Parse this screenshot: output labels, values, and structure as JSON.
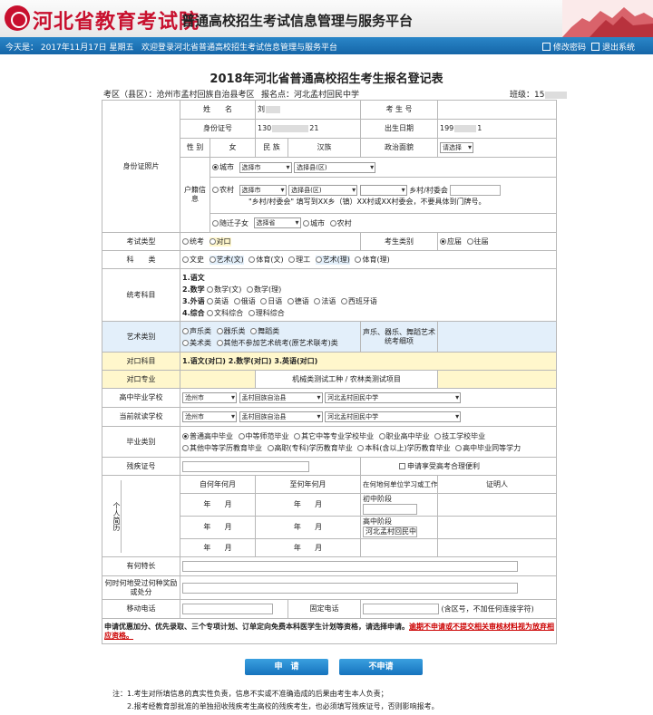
{
  "header": {
    "logo_text": "河北省教育考试院",
    "platform_title": "普通高校招生考试信息管理与服务平台"
  },
  "navbar": {
    "date_text": "今天是： 2017年11月17日 星期五",
    "welcome_text": "欢迎登录河北省普通高校招生考试信息管理与服务平台",
    "change_password": "修改密码",
    "logout": "退出系统"
  },
  "form": {
    "title": "2018年河北省普通高校招生考生报名登记表",
    "district_label": "考区（县区）：",
    "district_value": "沧州市孟村回族自治县考区",
    "school_label": "报名点：",
    "school_value": "河北孟村回民中学",
    "class_label": "班级：",
    "class_value": "15",
    "photo_label": "身份证照片",
    "name_label": "姓　　名",
    "name_value": "刘",
    "exam_no_label": "考 生 号",
    "exam_no_value": "",
    "id_label": "身份证号",
    "id_value_prefix": "130",
    "id_value_suffix": "21",
    "birth_label": "出生日期",
    "birth_value_prefix": "199",
    "birth_value_suffix": "1",
    "gender_label": "性 别",
    "gender_value": "女",
    "ethnic_label": "民 族",
    "ethnic_value": "汉族",
    "political_label": "政治面貌",
    "political_value": "请选择",
    "hukou_label": "户籍信息",
    "city_option": "城市",
    "city_select": "选择市",
    "county_select": "选择县(区)",
    "rural_option": "农村",
    "rural_city_select": "选择市",
    "rural_county_select": "选择县(区)",
    "village_label": "乡村/村委会",
    "village_note": "\"乡村/村委会\" 填写到XX乡（镇）XX村或XX村委会，不要具体到门牌号。",
    "migrant_option": "随迁子女",
    "migrant_select": "选择省",
    "migrant_city": "城市",
    "migrant_rural": "农村",
    "exam_type_label": "考试类型",
    "exam_type_options": [
      "统考",
      "对口"
    ],
    "student_cat_label": "考生类别",
    "student_cat_options": [
      "应届",
      "往届"
    ],
    "subject_label": "科　　类",
    "subject_options": [
      "文史",
      "艺术(文)",
      "体育(文)",
      "理工",
      "艺术(理)",
      "体育(理)"
    ],
    "unified_label": "统考科目",
    "unified_1": "1.语文",
    "unified_2": "2.数学",
    "unified_2_opts": [
      "数学(文)",
      "数学(理)"
    ],
    "unified_3": "3.外语",
    "unified_3_opts": [
      "英语",
      "俄语",
      "日语",
      "德语",
      "法语",
      "西班牙语"
    ],
    "unified_4": "4.综合",
    "unified_4_opts": [
      "文科综合",
      "理科综合"
    ],
    "art_label": "艺术类别",
    "art_opts_row1": [
      "声乐类",
      "器乐类",
      "舞蹈类"
    ],
    "art_opts_row2": [
      "美术类",
      "其他不参加艺术统考(原艺术联考)类"
    ],
    "art_note": "声乐、器乐、舞蹈艺术统考细项",
    "vocational_label": "对口科目",
    "vocational_value": "1.语文(对口)  2.数学(对口)  3.英语(对口)",
    "vocational_major_label": "对口专业",
    "vocational_major_value": "机械类测试工种 / 农林类测试项目",
    "hs_grad_label": "高中毕业学校",
    "hs_grad_city": "沧州市",
    "hs_grad_county": "孟村回族自治县",
    "hs_grad_school": "河北孟村回民中学",
    "current_school_label": "当前就读学校",
    "current_city": "沧州市",
    "current_county": "孟村回族自治县",
    "current_school": "河北孟村回民中学",
    "grad_type_label": "毕业类别",
    "grad_type_row1": [
      "普通高中毕业",
      "中等师范毕业",
      "其它中等专业学校毕业",
      "职业高中毕业",
      "技工学校毕业"
    ],
    "grad_type_row2": [
      "其他中等学历教育毕业",
      "高职(专科)学历教育毕业",
      "本科(含以上)学历教育毕业",
      "高中毕业同等学力"
    ],
    "disability_label": "残疾证号",
    "disability_check": "申请享受高考合理便利",
    "resume_label": "个人简历",
    "resume_headers": [
      "自何年何月",
      "至何年何月",
      "在何地何单位学习或工作",
      "证明人"
    ],
    "year_label": "年",
    "month_label": "月",
    "resume_rows": [
      {
        "stage": "初中阶段",
        "unit": ""
      },
      {
        "stage": "高中阶段",
        "unit": "河北孟村回民中学"
      },
      {
        "stage": "",
        "unit": ""
      }
    ],
    "specialty_label": "有何特长",
    "awards_label": "何时何地受过何种奖励或处分",
    "mobile_label": "移动电话",
    "landline_label": "固定电话",
    "landline_hint": "(含区号，不加任何连接字符)",
    "bonus_note": "申请优惠加分、优先录取、三个专项计划、订单定向免费本科医学生计划等资格，请选择申请。",
    "bonus_warning": "逾期不申请或不提交相关审核材料视为放弃相应资格。"
  },
  "buttons": {
    "apply": "申　请",
    "no_apply": "不申请"
  },
  "footnotes": {
    "line1": "注：1.考生对所填信息的真实性负责，信息不实或不准确造成的后果由考生本人负责；",
    "line2": "2.报考经教育部批准的单独招收残疾考生高校的残疾考生，也必须填写残疾证号，否则影响报考。"
  }
}
